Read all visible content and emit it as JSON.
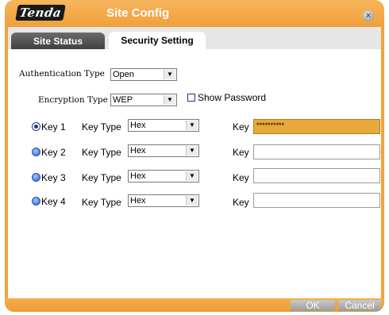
{
  "window": {
    "title": "Site Config",
    "logo_text": "Tenda",
    "close_glyph": "×"
  },
  "tabs": [
    {
      "label": "Site Status",
      "active": false
    },
    {
      "label": "Security Setting",
      "active": true
    }
  ],
  "security": {
    "authentication_type_label": "Authentication Type",
    "authentication_type_value": "Open",
    "encryption_type_label": "Encryption Type",
    "encryption_type_value": "WEP",
    "show_password_label": "Show Password",
    "show_password_checked": false
  },
  "keys": [
    {
      "label": "Key 1",
      "type_label": "Key Type",
      "type_value": "Hex",
      "key_label": "Key",
      "value": "**********",
      "selected": true
    },
    {
      "label": "Key 2",
      "type_label": "Key Type",
      "type_value": "Hex",
      "key_label": "Key",
      "value": "",
      "selected": false
    },
    {
      "label": "Key 3",
      "type_label": "Key Type",
      "type_value": "Hex",
      "key_label": "Key",
      "value": "",
      "selected": false
    },
    {
      "label": "Key 4",
      "type_label": "Key Type",
      "type_value": "Hex",
      "key_label": "Key",
      "value": "",
      "selected": false
    }
  ],
  "buttons": {
    "ok": "OK",
    "cancel": "Cancel"
  },
  "icons": {
    "dropdown": "chevron-down-icon",
    "close": "close-icon"
  },
  "colors": {
    "frame": "#f3a33b",
    "active_key_field": "#e9a83a",
    "active_tab": "#ffffff",
    "inactive_tab": "#4a4a4a"
  }
}
